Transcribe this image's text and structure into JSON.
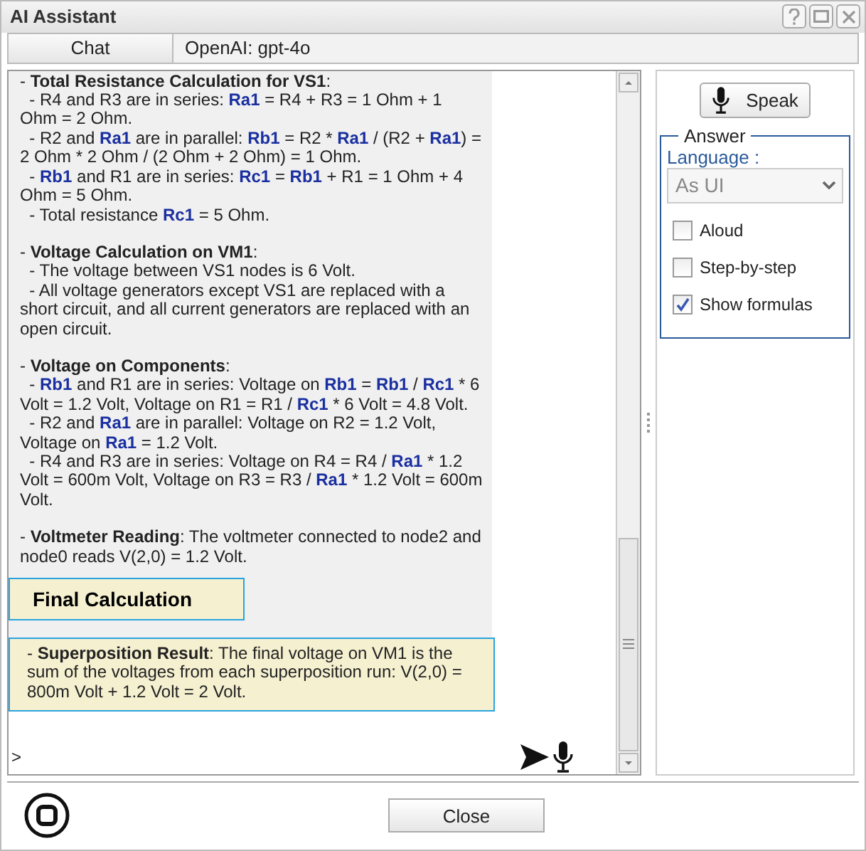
{
  "window": {
    "title": "AI Assistant"
  },
  "tabs": [
    {
      "label": "Chat",
      "selected": true
    }
  ],
  "model_label": "OpenAI: gpt-4o",
  "messages": [
    {
      "kind": "answer",
      "paragraphs": [
        [
          {
            "kind": "plain",
            "text": "- "
          },
          {
            "kind": "bold",
            "text": "Total Resistance Calculation for VS1"
          },
          {
            "kind": "plain",
            "text": ":"
          }
        ],
        [
          {
            "kind": "plain",
            "text": "  - R4 and R3 are in series: "
          },
          {
            "kind": "ref",
            "text": "Ra1"
          },
          {
            "kind": "plain",
            "text": " = R4 + R3 = 1 Ohm + 1 Ohm = 2 Ohm."
          }
        ],
        [
          {
            "kind": "plain",
            "text": "  - R2 and "
          },
          {
            "kind": "ref",
            "text": "Ra1"
          },
          {
            "kind": "plain",
            "text": " are in parallel: "
          },
          {
            "kind": "ref",
            "text": "Rb1"
          },
          {
            "kind": "plain",
            "text": " = R2 * "
          },
          {
            "kind": "ref",
            "text": "Ra1"
          },
          {
            "kind": "plain",
            "text": " / (R2 + "
          },
          {
            "kind": "ref",
            "text": "Ra1"
          },
          {
            "kind": "plain",
            "text": ") = 2 Ohm * 2 Ohm / (2 Ohm + 2 Ohm) = 1 Ohm."
          }
        ],
        [
          {
            "kind": "plain",
            "text": "  - "
          },
          {
            "kind": "ref",
            "text": "Rb1"
          },
          {
            "kind": "plain",
            "text": " and R1 are in series: "
          },
          {
            "kind": "ref",
            "text": "Rc1"
          },
          {
            "kind": "plain",
            "text": " = "
          },
          {
            "kind": "ref",
            "text": "Rb1"
          },
          {
            "kind": "plain",
            "text": " + R1 = 1 Ohm + 4 Ohm = 5 Ohm."
          }
        ],
        [
          {
            "kind": "plain",
            "text": "  - Total resistance "
          },
          {
            "kind": "ref",
            "text": "Rc1"
          },
          {
            "kind": "plain",
            "text": " = 5 Ohm."
          }
        ],
        [
          {
            "kind": "gap"
          }
        ],
        [
          {
            "kind": "plain",
            "text": "- "
          },
          {
            "kind": "bold",
            "text": "Voltage Calculation on VM1"
          },
          {
            "kind": "plain",
            "text": ":"
          }
        ],
        [
          {
            "kind": "plain",
            "text": "  - The voltage between VS1 nodes is 6 Volt."
          }
        ],
        [
          {
            "kind": "plain",
            "text": "  - All voltage generators except VS1 are replaced with a short circuit, and all current generators are replaced with an open circuit."
          }
        ],
        [
          {
            "kind": "gap"
          }
        ],
        [
          {
            "kind": "plain",
            "text": "- "
          },
          {
            "kind": "bold",
            "text": "Voltage on Components"
          },
          {
            "kind": "plain",
            "text": ":"
          }
        ],
        [
          {
            "kind": "plain",
            "text": "  - "
          },
          {
            "kind": "ref",
            "text": "Rb1"
          },
          {
            "kind": "plain",
            "text": " and R1 are in series: Voltage on "
          },
          {
            "kind": "ref",
            "text": "Rb1"
          },
          {
            "kind": "plain",
            "text": " = "
          },
          {
            "kind": "ref",
            "text": "Rb1"
          },
          {
            "kind": "plain",
            "text": " / "
          },
          {
            "kind": "ref",
            "text": "Rc1"
          },
          {
            "kind": "plain",
            "text": " * 6 Volt = 1.2 Volt, Voltage on R1 = R1 / "
          },
          {
            "kind": "ref",
            "text": "Rc1"
          },
          {
            "kind": "plain",
            "text": " * 6 Volt = 4.8 Volt."
          }
        ],
        [
          {
            "kind": "plain",
            "text": "  - R2 and "
          },
          {
            "kind": "ref",
            "text": "Ra1"
          },
          {
            "kind": "plain",
            "text": " are in parallel: Voltage on R2 = 1.2 Volt, Voltage on "
          },
          {
            "kind": "ref",
            "text": "Ra1"
          },
          {
            "kind": "plain",
            "text": " = 1.2 Volt."
          }
        ],
        [
          {
            "kind": "plain",
            "text": "  - R4 and R3 are in series: Voltage on R4 = R4 / "
          },
          {
            "kind": "ref",
            "text": "Ra1"
          },
          {
            "kind": "plain",
            "text": " * 1.2 Volt = 600m Volt, Voltage on R3 = R3 / "
          },
          {
            "kind": "ref",
            "text": "Ra1"
          },
          {
            "kind": "plain",
            "text": " * 1.2 Volt = 600m Volt."
          }
        ],
        [
          {
            "kind": "gap"
          }
        ],
        [
          {
            "kind": "plain",
            "text": "- "
          },
          {
            "kind": "bold",
            "text": "Voltmeter Reading"
          },
          {
            "kind": "plain",
            "text": ": The voltmeter connected to node2 and node0 reads V(2,0) = 1.2 Volt."
          }
        ]
      ]
    },
    {
      "kind": "heading",
      "text": "Final Calculation"
    },
    {
      "kind": "highlight",
      "paragraphs": [
        [
          {
            "kind": "plain",
            "text": "- "
          },
          {
            "kind": "bold",
            "text": "Superposition Result"
          },
          {
            "kind": "plain",
            "text": ": The final voltage on VM1 is the sum of the voltages from each superposition run: V(2,0) = 800m Volt + 1.2 Volt = 2 Volt."
          }
        ]
      ]
    }
  ],
  "input": {
    "value": ">"
  },
  "speak_button": "Speak",
  "answer": {
    "legend": "Answer",
    "language_label": "Language :",
    "language": {
      "value": "As UI",
      "disabled": true
    },
    "options": [
      {
        "label": "Aloud",
        "checked": false
      },
      {
        "label": "Step-by-step",
        "checked": false
      },
      {
        "label": "Show formulas",
        "checked": true
      }
    ]
  },
  "close_button": "Close"
}
